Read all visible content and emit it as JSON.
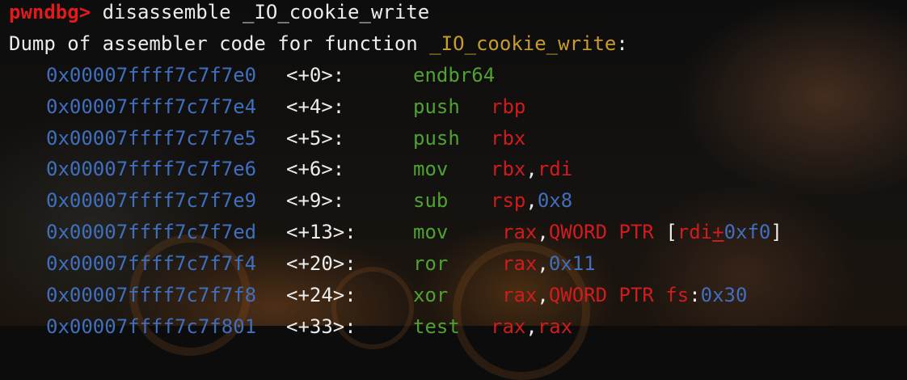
{
  "prompt": "pwndbg>",
  "command": "disassemble _IO_cookie_write",
  "dump_header_prefix": "Dump of assembler code for function ",
  "function_name": "_IO_cookie_write",
  "dump_header_suffix": ":",
  "colors": {
    "prompt": "#e01b1b",
    "address": "#3f6fbf",
    "mnemonic": "#4fa232",
    "register": "#d01c1c",
    "function": "#c89b2a",
    "text": "#ececec"
  },
  "instructions": [
    {
      "address": "0x00007ffff7c7f7e0",
      "offset": "<+0>:",
      "mnemonic": "endbr64",
      "operands": []
    },
    {
      "address": "0x00007ffff7c7f7e4",
      "offset": "<+4>:",
      "mnemonic": "push",
      "operands": [
        {
          "text": "rbp",
          "type": "reg"
        }
      ]
    },
    {
      "address": "0x00007ffff7c7f7e5",
      "offset": "<+5>:",
      "mnemonic": "push",
      "operands": [
        {
          "text": "rbx",
          "type": "reg"
        }
      ]
    },
    {
      "address": "0x00007ffff7c7f7e6",
      "offset": "<+6>:",
      "mnemonic": "mov",
      "operands": [
        {
          "text": "rbx",
          "type": "reg"
        },
        {
          "text": ",",
          "type": "punc"
        },
        {
          "text": "rdi",
          "type": "reg"
        }
      ]
    },
    {
      "address": "0x00007ffff7c7f7e9",
      "offset": "<+9>:",
      "mnemonic": "sub",
      "operands": [
        {
          "text": "rsp",
          "type": "reg"
        },
        {
          "text": ",",
          "type": "punc"
        },
        {
          "text": "0x8",
          "type": "num"
        }
      ]
    },
    {
      "address": "0x00007ffff7c7f7ed",
      "offset": "<+13>:",
      "mnemonic": "mov",
      "operands": [
        {
          "text": "rax",
          "type": "reg"
        },
        {
          "text": ",",
          "type": "punc"
        },
        {
          "text": "QWORD PTR ",
          "type": "reg"
        },
        {
          "text": "[",
          "type": "punc"
        },
        {
          "text": "rdi",
          "type": "reg"
        },
        {
          "text": "+",
          "type": "lnk"
        },
        {
          "text": "0xf0",
          "type": "num"
        },
        {
          "text": "]",
          "type": "punc"
        }
      ]
    },
    {
      "address": "0x00007ffff7c7f7f4",
      "offset": "<+20>:",
      "mnemonic": "ror",
      "operands": [
        {
          "text": "rax",
          "type": "reg"
        },
        {
          "text": ",",
          "type": "punc"
        },
        {
          "text": "0x11",
          "type": "num"
        }
      ]
    },
    {
      "address": "0x00007ffff7c7f7f8",
      "offset": "<+24>:",
      "mnemonic": "xor",
      "operands": [
        {
          "text": "rax",
          "type": "reg"
        },
        {
          "text": ",",
          "type": "punc"
        },
        {
          "text": "QWORD PTR fs",
          "type": "reg"
        },
        {
          "text": ":",
          "type": "punc"
        },
        {
          "text": "0x30",
          "type": "num"
        }
      ]
    },
    {
      "address": "0x00007ffff7c7f801",
      "offset": "<+33>:",
      "mnemonic": "test",
      "operands": [
        {
          "text": "rax",
          "type": "reg"
        },
        {
          "text": ",",
          "type": "punc"
        },
        {
          "text": "rax",
          "type": "reg"
        }
      ]
    }
  ]
}
